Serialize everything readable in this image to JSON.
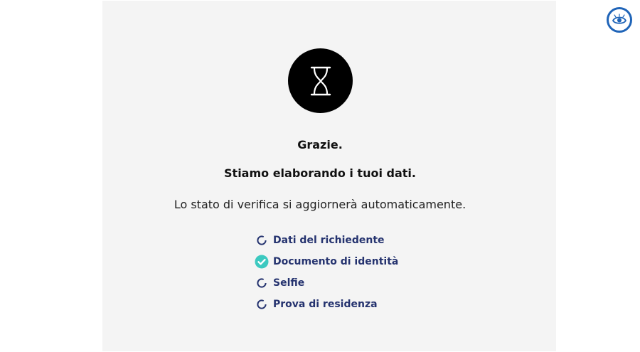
{
  "header": {
    "brand_icon": "eye-logo-icon",
    "brand_color": "#1f64b8"
  },
  "status": {
    "icon": "hourglass-icon",
    "thanks": "Grazie.",
    "processing": "Stiamo elaborando i tuoi dati.",
    "auto_update": "Lo stato di verifica si aggiornerà automaticamente."
  },
  "steps": [
    {
      "label": "Dati del richiedente",
      "state": "pending",
      "icon": "loading-ring-icon"
    },
    {
      "label": "Documento di identità",
      "state": "completed",
      "icon": "check-circle-icon"
    },
    {
      "label": "Selfie",
      "state": "pending",
      "icon": "loading-ring-icon"
    },
    {
      "label": "Prova di residenza",
      "state": "pending",
      "icon": "loading-ring-icon"
    }
  ],
  "colors": {
    "step_text": "#25336f",
    "completed": "#3cc9c0",
    "pending_ring": "#25336f",
    "panel_background": "#f4f4f4"
  }
}
